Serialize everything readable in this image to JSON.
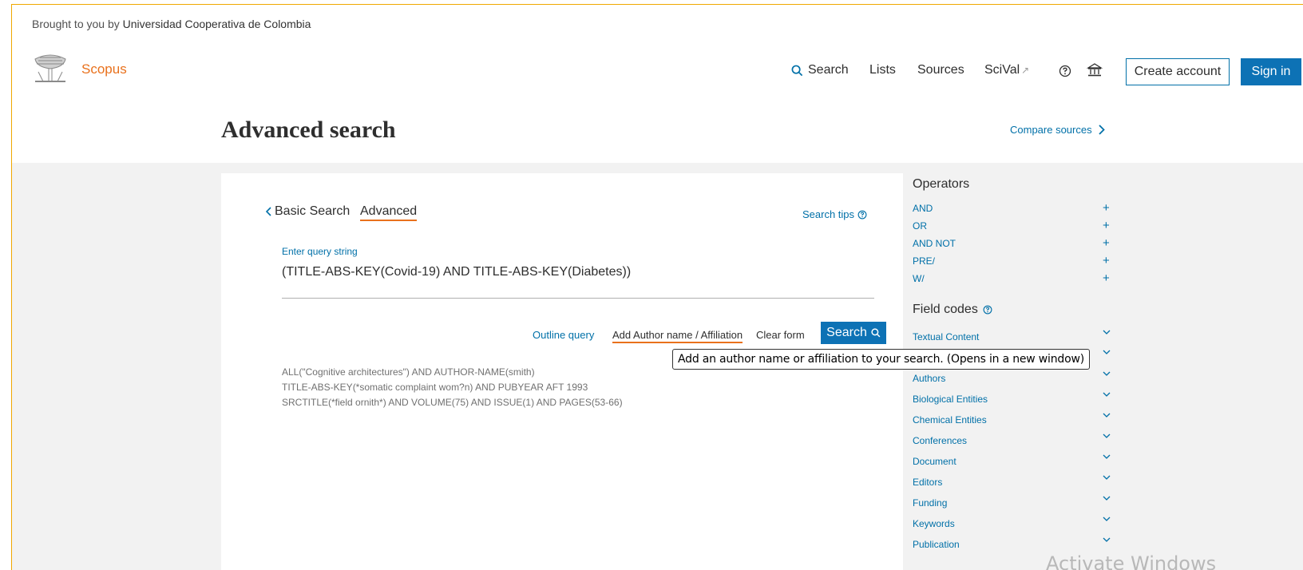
{
  "header": {
    "brought_prefix": "Brought to you by",
    "institution": "Universidad Cooperativa de Colombia",
    "logo_text": "Scopus",
    "nav": {
      "search": "Search",
      "lists": "Lists",
      "sources": "Sources",
      "scival": "SciVal",
      "scival_ext": "↗"
    },
    "create_account": "Create account",
    "sign_in": "Sign in"
  },
  "page": {
    "title": "Advanced search",
    "compare_sources": "Compare sources"
  },
  "search_card": {
    "back_label": "Basic Search",
    "active_tab": "Advanced",
    "search_tips": "Search tips",
    "query_label": "Enter query string",
    "query_value": "(TITLE-ABS-KEY(Covid-19) AND TITLE-ABS-KEY(Diabetes))",
    "actions": {
      "outline": "Outline query",
      "add_author": "Add Author name / Affiliation",
      "clear": "Clear form",
      "search": "Search"
    },
    "examples": [
      "ALL(\"Cognitive architectures\") AND AUTHOR-NAME(smith)",
      "TITLE-ABS-KEY(*somatic complaint wom?n) AND PUBYEAR AFT 1993",
      "SRCTITLE(*field ornith*) AND VOLUME(75) AND ISSUE(1) AND PAGES(53-66)"
    ]
  },
  "tooltip": "Add an author name or affiliation to your search. (Opens in a new window)",
  "sidebar": {
    "operators_title": "Operators",
    "operators": [
      "AND",
      "OR",
      "AND NOT",
      "PRE/",
      "W/"
    ],
    "field_codes_title": "Field codes",
    "field_codes": [
      "Textual Content",
      "",
      "Authors",
      "Biological Entities",
      "Chemical Entities",
      "Conferences",
      "Document",
      "Editors",
      "Funding",
      "Keywords",
      "Publication"
    ]
  },
  "watermark": "Activate Windows",
  "colors": {
    "accent_blue": "#0070a8",
    "button_blue": "#0d72b5",
    "brand_orange": "#e9711c",
    "frame_border": "#f0a800"
  }
}
